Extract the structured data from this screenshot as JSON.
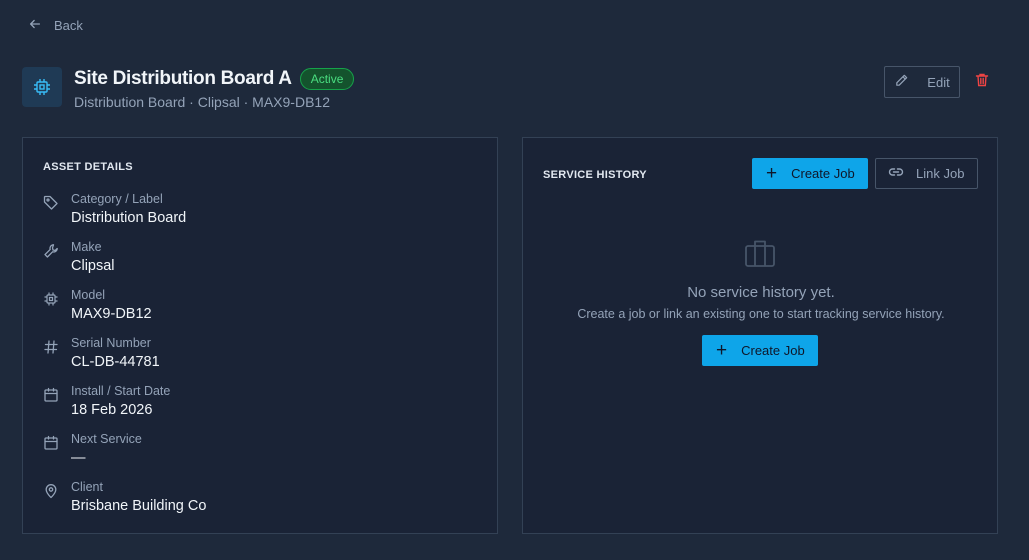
{
  "nav": {
    "back_label": "Back"
  },
  "asset": {
    "title": "Site Distribution Board A",
    "status": "Active",
    "subtitle": "Distribution Board · Clipsal · MAX9-DB12"
  },
  "actions": {
    "edit_label": "Edit"
  },
  "details": {
    "heading": "ASSET DETAILS",
    "items": [
      {
        "label": "Category / Label",
        "value": "Distribution Board",
        "icon": "tag-icon"
      },
      {
        "label": "Make",
        "value": "Clipsal",
        "icon": "wrench-icon"
      },
      {
        "label": "Model",
        "value": "MAX9-DB12",
        "icon": "chip-icon"
      },
      {
        "label": "Serial Number",
        "value": "CL-DB-44781",
        "icon": "hash-icon"
      },
      {
        "label": "Install / Start Date",
        "value": "18 Feb 2026",
        "icon": "calendar-icon"
      },
      {
        "label": "Next Service",
        "value": "—",
        "icon": "calendar-icon"
      },
      {
        "label": "Client",
        "value": "Brisbane Building Co",
        "icon": "map-pin-icon"
      }
    ]
  },
  "service": {
    "heading": "SERVICE HISTORY",
    "create_label": "Create Job",
    "link_label": "Link Job",
    "empty_title": "No service history yet.",
    "empty_sub": "Create a job or link an existing one to start tracking service history.",
    "empty_create_label": "Create Job"
  },
  "colors": {
    "background": "#1e293b",
    "panel": "#1a2336",
    "accent": "#0ea5e9",
    "active": "#4ade80",
    "danger": "#ef4444"
  }
}
